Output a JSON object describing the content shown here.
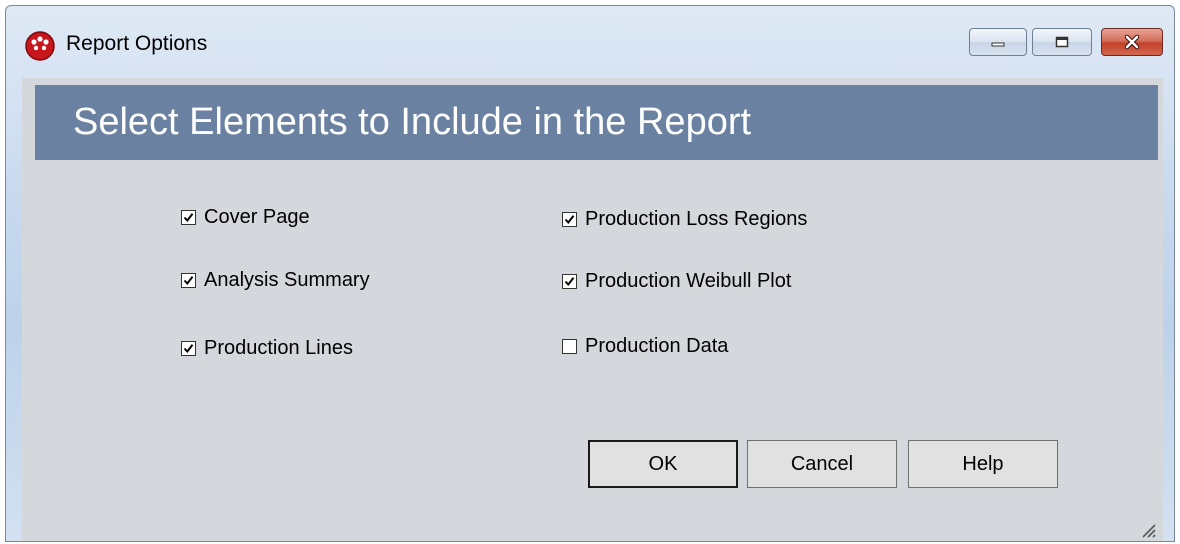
{
  "window": {
    "title": "Report Options",
    "icon": "red-app-icon",
    "controls": [
      "minimize-icon",
      "maximize-icon",
      "close-icon"
    ]
  },
  "banner": {
    "heading": "Select Elements to Include in the Report",
    "color": "#6a81a1"
  },
  "options": {
    "cover_page": {
      "label": "Cover Page",
      "checked": true
    },
    "analysis_summary": {
      "label": "Analysis Summary",
      "checked": true
    },
    "production_lines": {
      "label": "Production Lines",
      "checked": true
    },
    "production_loss_regions": {
      "label": "Production Loss Regions",
      "checked": true
    },
    "production_weibull_plot": {
      "label": "Production Weibull Plot",
      "checked": true
    },
    "production_data": {
      "label": "Production Data",
      "checked": false
    }
  },
  "buttons": {
    "ok": "OK",
    "cancel": "Cancel",
    "help": "Help"
  }
}
